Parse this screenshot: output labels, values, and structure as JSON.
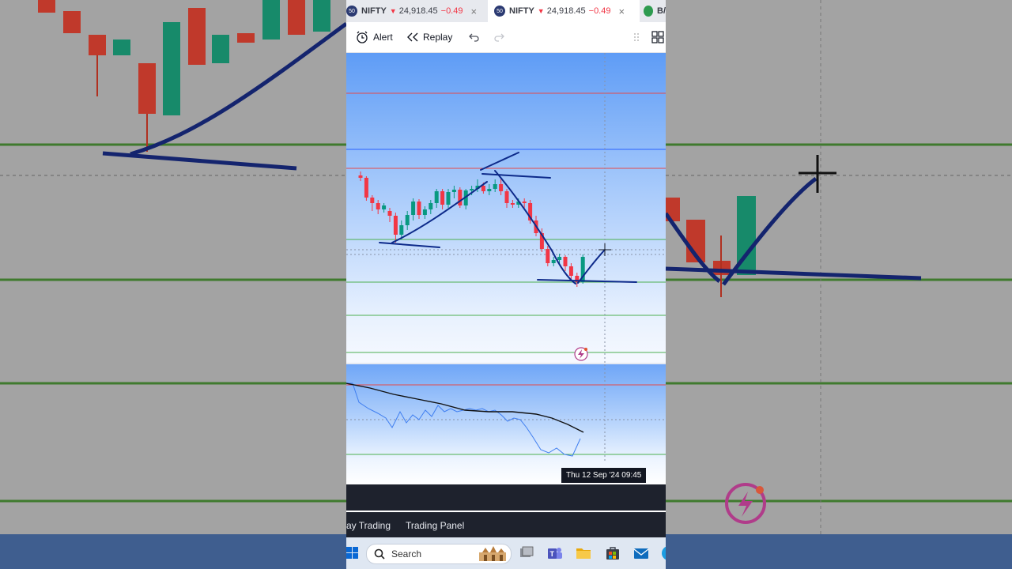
{
  "tabs": [
    {
      "badge": "50",
      "symbol": "NIFTY",
      "price": "24,918.45",
      "change": "−0.49",
      "close": "×",
      "active": false
    },
    {
      "badge": "50",
      "symbol": "NIFTY",
      "price": "24,918.45",
      "change": "−0.49",
      "close": "×",
      "active": true
    },
    {
      "badge": "",
      "symbol": "B/",
      "price": "",
      "change": "",
      "close": "",
      "active": false
    }
  ],
  "toolbar": {
    "alert_label": "Alert",
    "replay_label": "Replay",
    "undo_icon": "undo-icon",
    "redo_icon": "redo-icon",
    "layout_icon": "layout-icon"
  },
  "chart": {
    "crosshair_date": "Thu 12 Sep '24   09:45",
    "colors": {
      "up": "#089981",
      "down": "#f23645",
      "drawing": "#0d2a8a",
      "level_red": "#f23645",
      "level_green": "#4caf50",
      "level_blue": "#2962ff"
    }
  },
  "bottom_tabs": {
    "trading": "ay Trading",
    "panel": "Trading Panel"
  },
  "taskbar": {
    "search_placeholder": "Search"
  }
}
